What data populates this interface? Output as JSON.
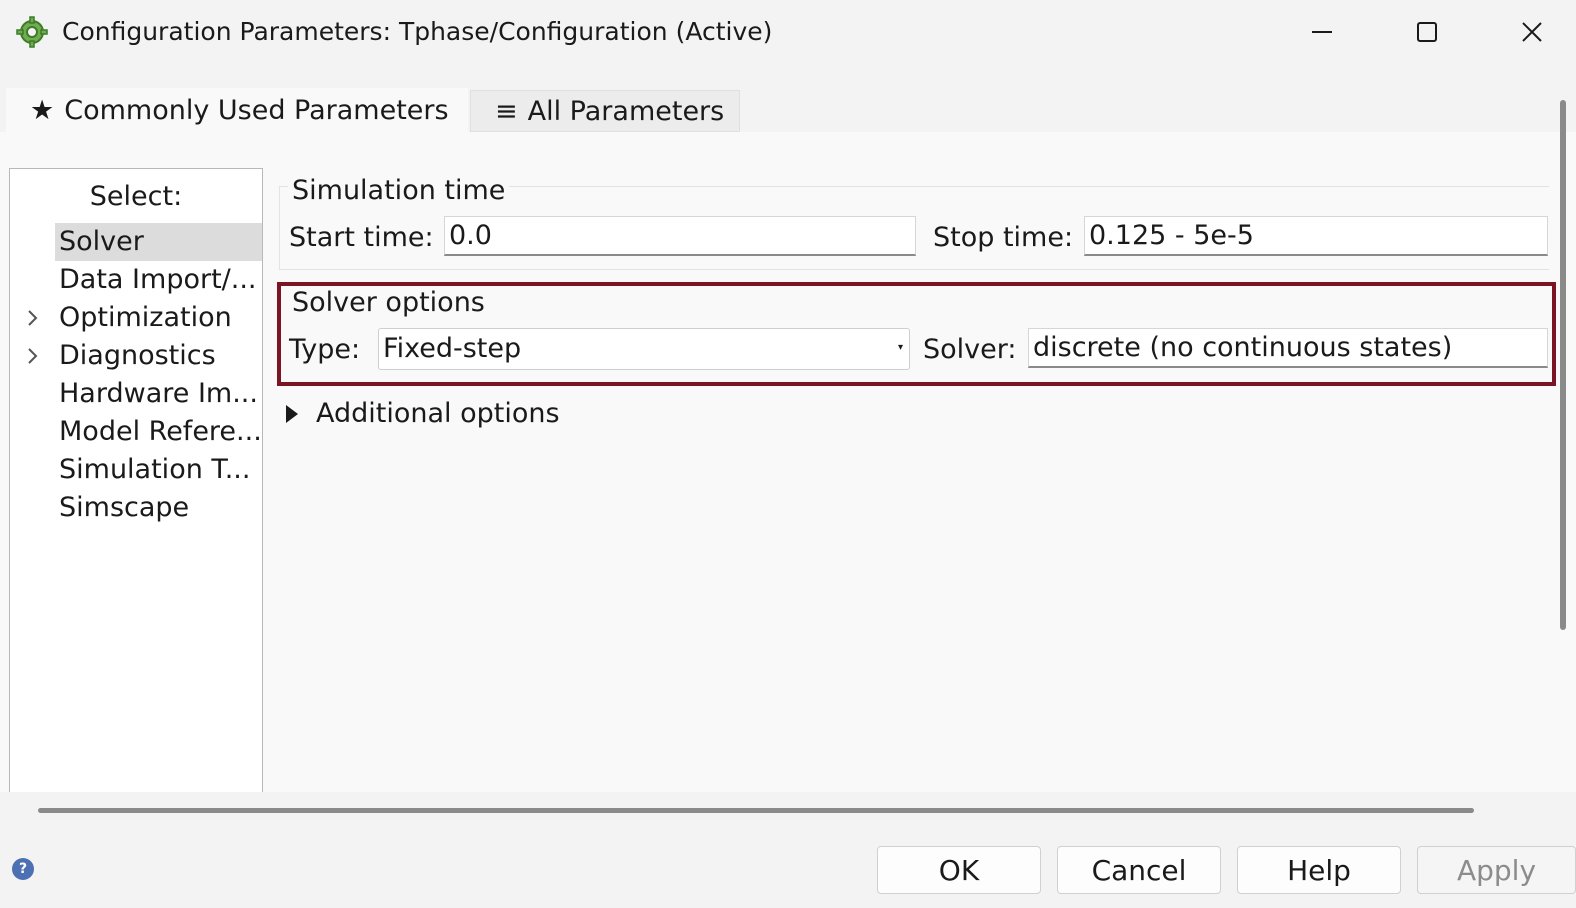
{
  "window": {
    "title": "Configuration Parameters: Tphase/Configuration (Active)",
    "app_icon": "gear-cog-icon",
    "controls": [
      "minimize-icon",
      "maximize-icon",
      "close-icon"
    ]
  },
  "tabs": [
    {
      "icon": "★",
      "label": "Commonly Used Parameters",
      "active": true
    },
    {
      "icon": "≡",
      "label": "All Parameters",
      "active": false
    }
  ],
  "nav": {
    "header": "Select:",
    "items": [
      {
        "label": "Solver",
        "selected": true,
        "expandable": false
      },
      {
        "label": "Data Import/...",
        "selected": false,
        "expandable": false
      },
      {
        "label": "Optimization",
        "selected": false,
        "expandable": true
      },
      {
        "label": "Diagnostics",
        "selected": false,
        "expandable": true
      },
      {
        "label": "Hardware Im...",
        "selected": false,
        "expandable": false
      },
      {
        "label": "Model Refere...",
        "selected": false,
        "expandable": false
      },
      {
        "label": "Simulation T...",
        "selected": false,
        "expandable": false
      },
      {
        "label": "Simscape",
        "selected": false,
        "expandable": false
      }
    ]
  },
  "simulation_time": {
    "title": "Simulation time",
    "start_label": "Start time:",
    "start_value": "0.0",
    "stop_label": "Stop time:",
    "stop_value": "0.125 - 5e-5"
  },
  "solver_options": {
    "title": "Solver options",
    "type_label": "Type:",
    "type_value": "Fixed-step",
    "solver_label": "Solver:",
    "solver_value": "discrete (no continuous states)",
    "highlight_color": "#7b1523"
  },
  "additional_options": {
    "label": "Additional options"
  },
  "buttons": {
    "ok": "OK",
    "cancel": "Cancel",
    "help": "Help",
    "apply": "Apply"
  }
}
